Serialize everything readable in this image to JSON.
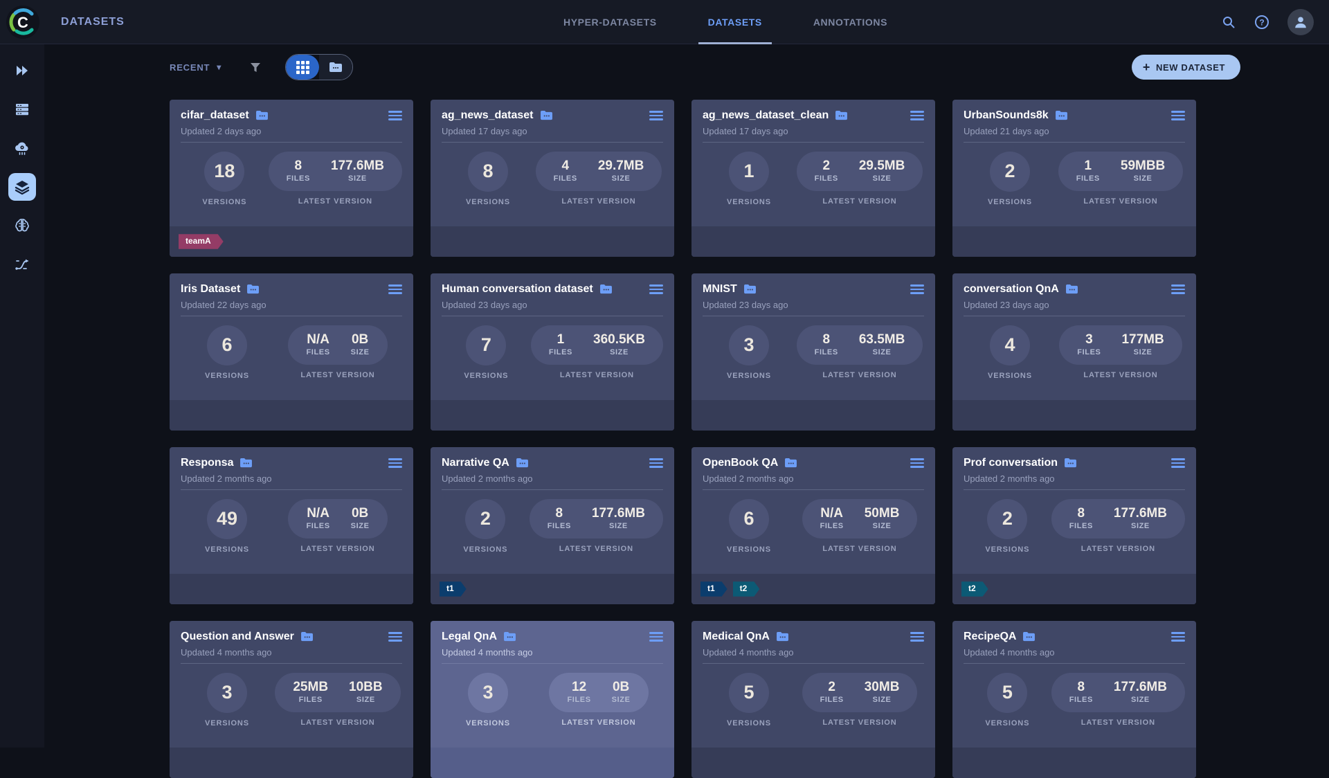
{
  "page_title": "DATASETS",
  "header": {
    "tabs": [
      {
        "label": "HYPER-DATASETS",
        "active": false
      },
      {
        "label": "DATASETS",
        "active": true
      },
      {
        "label": "ANNOTATIONS",
        "active": false
      }
    ],
    "icons": [
      "search-icon",
      "help-icon",
      "user-avatar"
    ]
  },
  "sidebar": {
    "items": [
      {
        "icon": "double-chevron-icon",
        "active": false
      },
      {
        "icon": "workers-queues-icon",
        "active": false
      },
      {
        "icon": "cloud-autoscaler-icon",
        "active": false
      },
      {
        "icon": "datasets-layers-icon",
        "active": true
      },
      {
        "icon": "models-brain-icon",
        "active": false
      },
      {
        "icon": "pipelines-icon",
        "active": false
      }
    ]
  },
  "toolbar": {
    "sort_label": "RECENT",
    "caret": "▾",
    "view_modes": [
      "grid",
      "table"
    ],
    "active_view": "grid",
    "new_dataset_label": "NEW DATASET",
    "plus": "+"
  },
  "card_labels": {
    "versions": "VERSIONS",
    "files": "FILES",
    "size": "SIZE",
    "latest_version": "LATEST VERSION"
  },
  "colors": {
    "accent_blue": "#6d9ef7",
    "active_tab": "#6d9ef7",
    "new_button_bg": "#a9c7f2",
    "active_toggle": "#2b66c9",
    "tag_teamA": "#943c66",
    "tag_t1": "#0b3d6d",
    "tag_t2": "#0c5a75"
  },
  "datasets": [
    {
      "name": "cifar_dataset",
      "updated": "Updated 2 days ago",
      "versions": "18",
      "files": "8",
      "size": "177.6MB",
      "tags": [
        {
          "label": "teamA",
          "color": "#943c66"
        }
      ]
    },
    {
      "name": "ag_news_dataset",
      "updated": "Updated 17 days ago",
      "versions": "8",
      "files": "4",
      "size": "29.7MB",
      "tags": []
    },
    {
      "name": "ag_news_dataset_clean",
      "updated": "Updated 17 days ago",
      "versions": "1",
      "files": "2",
      "size": "29.5MB",
      "tags": []
    },
    {
      "name": "UrbanSounds8k",
      "updated": "Updated 21 days ago",
      "versions": "2",
      "files": "1",
      "size": "59MBB",
      "tags": []
    },
    {
      "name": "Iris Dataset",
      "updated": "Updated 22 days ago",
      "versions": "6",
      "files": "N/A",
      "size": "0B",
      "tags": []
    },
    {
      "name": "Human conversation dataset",
      "updated": "Updated 23 days ago",
      "versions": "7",
      "files": "1",
      "size": "360.5KB",
      "tags": []
    },
    {
      "name": "MNIST",
      "updated": "Updated 23 days ago",
      "versions": "3",
      "files": "8",
      "size": "63.5MB",
      "tags": []
    },
    {
      "name": "conversation QnA",
      "updated": "Updated 23 days ago",
      "versions": "4",
      "files": "3",
      "size": "177MB",
      "tags": []
    },
    {
      "name": "Responsa",
      "updated": "Updated 2 months ago",
      "versions": "49",
      "files": "N/A",
      "size": "0B",
      "tags": []
    },
    {
      "name": "Narrative QA",
      "updated": "Updated 2 months ago",
      "versions": "2",
      "files": "8",
      "size": "177.6MB",
      "tags": [
        {
          "label": "t1",
          "color": "#0b3d6d"
        }
      ]
    },
    {
      "name": "OpenBook QA",
      "updated": "Updated 2 months ago",
      "versions": "6",
      "files": "N/A",
      "size": "50MB",
      "tags": [
        {
          "label": "t1",
          "color": "#0b3d6d"
        },
        {
          "label": "t2",
          "color": "#0c5a75"
        }
      ]
    },
    {
      "name": "Prof conversation",
      "updated": "Updated 2 months ago",
      "versions": "2",
      "files": "8",
      "size": "177.6MB",
      "tags": [
        {
          "label": "t2",
          "color": "#0c5a75"
        }
      ]
    },
    {
      "name": "Question and Answer",
      "updated": "Updated 4 months ago",
      "versions": "3",
      "files": "25MB",
      "size": "10BB",
      "tags": []
    },
    {
      "name": "Legal QnA",
      "updated": "Updated 4 months ago",
      "versions": "3",
      "files": "12",
      "size": "0B",
      "tags": [],
      "highlighted": true
    },
    {
      "name": "Medical QnA",
      "updated": "Updated 4 months ago",
      "versions": "5",
      "files": "2",
      "size": "30MB",
      "tags": []
    },
    {
      "name": "RecipeQA",
      "updated": "Updated 4 months ago",
      "versions": "5",
      "files": "8",
      "size": "177.6MB",
      "tags": []
    }
  ]
}
